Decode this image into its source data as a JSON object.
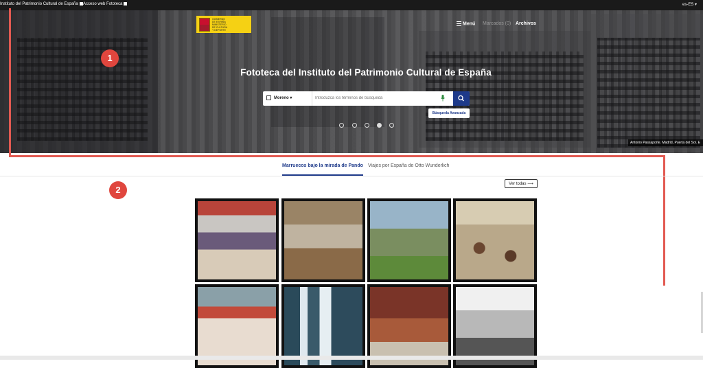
{
  "topbar": {
    "links": [
      {
        "label": "Instituto del Patrimonio Cultural de España"
      },
      {
        "label": "Acceso web Fototeca"
      }
    ],
    "language": "es-ES"
  },
  "header": {
    "logo_caption": "GOBIERNO DE ESPAÑA  MINISTERIO DE CULTURA Y DEPORTE",
    "nav": {
      "menu": "Menú",
      "bookmarks": "Marcados (0)",
      "archives": "Archivos"
    }
  },
  "hero": {
    "title": "Fototeca del Instituto del Patrimonio Cultural de España",
    "search": {
      "scope_label": "Moreno",
      "placeholder": "Introduzca los términos de búsqueda"
    },
    "advanced_search": "Búsqueda Avanzada",
    "photo_caption": "Antonio Passaporte. Madrid, Puerta del Sol. E",
    "carousel_dots": 5
  },
  "annotations": {
    "badge_1": "1",
    "badge_2": "2",
    "color": "#e25a52"
  },
  "collections": {
    "tabs": [
      {
        "label": "Marruecos bajo la mirada de Pando",
        "active": true
      },
      {
        "label": "Viajes por España de Otto Wunderlich",
        "active": false
      }
    ],
    "see_all": "Ver todas"
  },
  "colors": {
    "primary": "#1e3a8a",
    "topbar": "#1a1a1a",
    "logo_yellow": "#f5d114",
    "annotation": "#e0463e"
  }
}
